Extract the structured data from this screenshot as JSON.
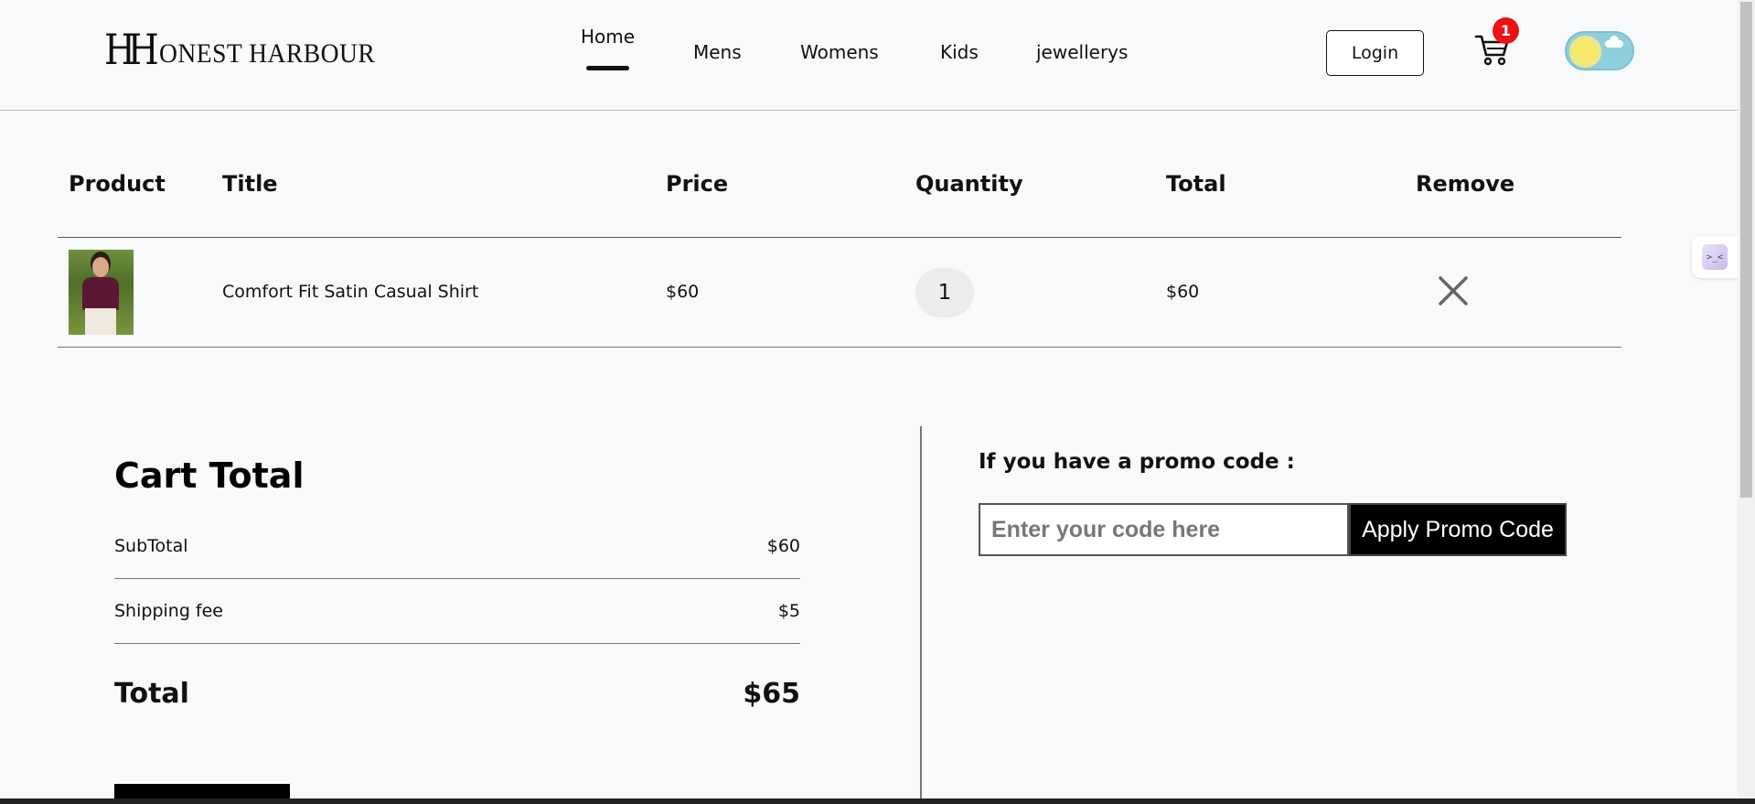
{
  "header": {
    "logo_mark": "HH",
    "logo_text": "ONEST HARBOUR",
    "nav": [
      {
        "label": "Home",
        "active": true
      },
      {
        "label": "Mens",
        "active": false
      },
      {
        "label": "Womens",
        "active": false
      },
      {
        "label": "Kids",
        "active": false
      },
      {
        "label": "jewellerys",
        "active": false
      }
    ],
    "login_label": "Login",
    "cart_count": "1"
  },
  "side_widget": {
    "face": ">_<"
  },
  "table": {
    "headers": [
      "Product",
      "Title",
      "Price",
      "Quantity",
      "Total",
      "Remove"
    ],
    "rows": [
      {
        "title": "Comfort Fit Satin Casual Shirt",
        "price": "$60",
        "quantity": "1",
        "total": "$60"
      }
    ]
  },
  "cart_total": {
    "heading": "Cart Total",
    "subtotal_label": "SubTotal",
    "subtotal_value": "$60",
    "shipping_label": "Shipping fee",
    "shipping_value": "$5",
    "total_label": "Total",
    "total_value": "$65"
  },
  "promo": {
    "title": "If you have a promo code :",
    "placeholder": "Enter your code here",
    "button_label": "Apply Promo Code"
  },
  "colors": {
    "badge": "#ee1111",
    "toggle": "#8ecfdc",
    "sun": "#f5e76a",
    "background": "#f8f9fb"
  }
}
